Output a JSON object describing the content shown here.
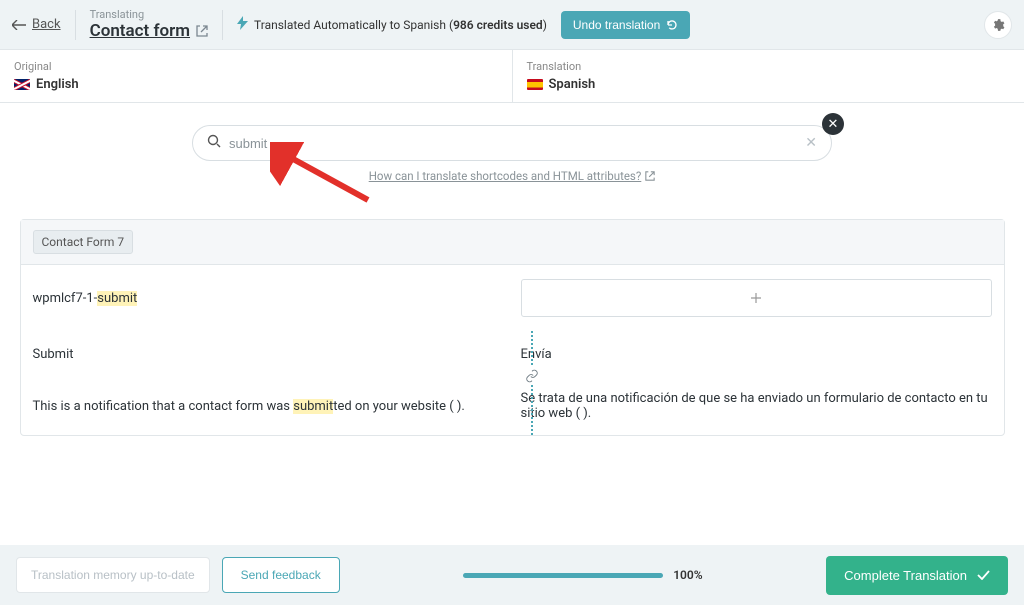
{
  "topbar": {
    "back_label": "Back",
    "translating_label": "Translating",
    "page_title": "Contact form",
    "auto_text_prefix": "Translated Automatically to Spanish (",
    "credits_text": "986 credits used",
    "auto_text_suffix": ")",
    "undo_label": "Undo translation"
  },
  "languages": {
    "original_label": "Original",
    "original_name": "English",
    "translation_label": "Translation",
    "translation_name": "Spanish"
  },
  "search": {
    "value": "submit",
    "help_text": "How can I translate shortcodes and HTML attributes?"
  },
  "group": {
    "chip": "Contact Form 7"
  },
  "rows": [
    {
      "left_pre": "wpmlcf7-1-",
      "left_hl": "submit",
      "left_post": "",
      "right": ""
    },
    {
      "left_pre": "",
      "left_hl": "Submit",
      "left_post": "",
      "right": "Envía"
    },
    {
      "left_pre": "This is a notification that a contact form was ",
      "left_hl": "submit",
      "left_post": "ted on your website ( ).",
      "right": "Se trata de una notificación de que se ha enviado un formulario de contacto en tu sitio web ( )."
    }
  ],
  "footer": {
    "memory_label": "Translation memory up-to-date",
    "feedback_label": "Send feedback",
    "progress_text": "100%",
    "complete_label": "Complete Translation"
  }
}
